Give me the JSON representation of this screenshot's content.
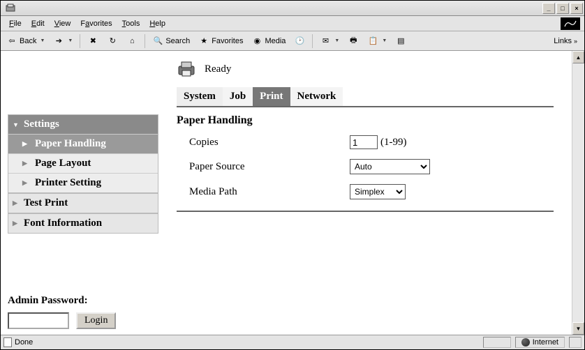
{
  "window": {
    "minimize": "_",
    "maximize": "□",
    "close": "×"
  },
  "menu": {
    "file": "File",
    "edit": "Edit",
    "view": "View",
    "favorites": "Favorites",
    "tools": "Tools",
    "help": "Help"
  },
  "toolbar": {
    "back": "Back",
    "search": "Search",
    "favorites": "Favorites",
    "media": "Media",
    "links": "Links"
  },
  "status": {
    "text": "Ready"
  },
  "tabs": {
    "system": "System",
    "job": "Job",
    "print": "Print",
    "network": "Network"
  },
  "sidebar": {
    "settings": "Settings",
    "paper_handling": "Paper Handling",
    "page_layout": "Page Layout",
    "printer_setting": "Printer Setting",
    "test_print": "Test Print",
    "font_information": "Font Information"
  },
  "panel": {
    "title": "Paper Handling",
    "copies_label": "Copies",
    "copies_value": "1",
    "copies_range": "(1-99)",
    "paper_source_label": "Paper Source",
    "paper_source_value": "Auto",
    "media_path_label": "Media Path",
    "media_path_value": "Simplex"
  },
  "admin": {
    "label": "Admin Password:",
    "login_btn": "Login"
  },
  "statusbar": {
    "done": "Done",
    "zone": "Internet"
  }
}
